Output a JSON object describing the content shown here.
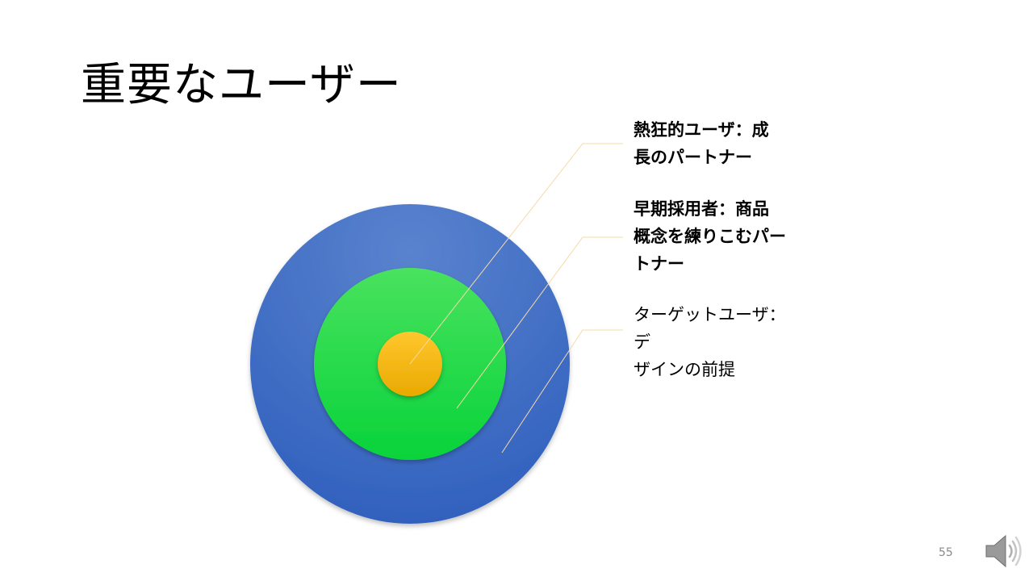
{
  "title": "重要なユーザー",
  "rings": [
    {
      "label": "熱狂的ユーザ：成長のパートナー",
      "label_lines": [
        "熱狂的ユーザ：成",
        "長のパートナー"
      ],
      "color": "#fbbf14",
      "bold": true
    },
    {
      "label": "早期採用者：商品概念を練りこむパートナー",
      "label_lines": [
        "早期採用者：商品",
        "概念を練りこむパー",
        "トナー"
      ],
      "color": "#15de3d",
      "bold": true
    },
    {
      "label": "ターゲットユーザ：デザインの前提",
      "label_lines": [
        "ターゲットユーザ：デ",
        "ザインの前提"
      ],
      "color": "#3d6cc9",
      "bold": false
    }
  ],
  "leader_line_color": "#f7d9a8",
  "page_number": "55",
  "icons": {
    "audio": "speaker-icon"
  }
}
